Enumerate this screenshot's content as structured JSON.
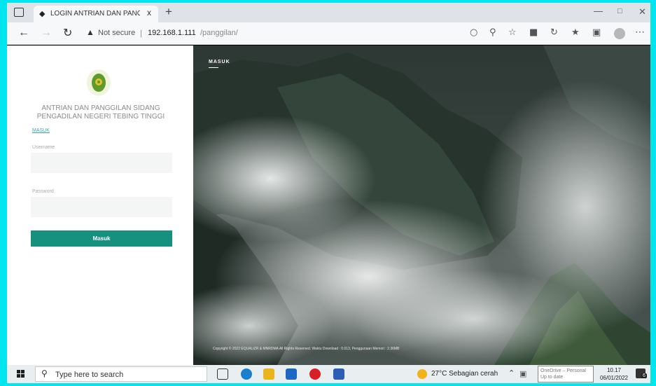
{
  "browser": {
    "tab_title": "LOGIN ANTRIAN DAN PANGGI...",
    "tab_favicon": "◆",
    "new_tab_symbol": "+",
    "close_symbol": "x",
    "not_secure": "Not secure",
    "url_host": "192.168.1.111",
    "url_path": "/panggilan/"
  },
  "login": {
    "title_line1": "ANTRIAN DAN PANGGILAN SIDANG",
    "title_line2": "PENGADILAN NEGERI TEBING TINGGI",
    "tab_label": "MASUK",
    "username_label": "Username",
    "password_label": "Password",
    "submit_label": "Masuk"
  },
  "hero": {
    "label": "MASUK",
    "footer": "Copyright © 2022 EQUALIZR & MNRDMA All Rights Reserved. Waktu Download : 0.013, Penggunaan Memori : 2.36MB"
  },
  "taskbar": {
    "search_placeholder": "Type here to search",
    "weather": "27°C  Sebagian cerah",
    "onedrive_line1": "OneDrive – Personal",
    "onedrive_line2": "Up to date",
    "time": "10.17",
    "date": "06/01/2022",
    "notification_count": "6"
  },
  "colors": {
    "accent": "#17917f",
    "screen_border": "#00e5ee"
  },
  "icons": [
    "back-arrow-icon",
    "forward-arrow-icon",
    "reload-icon",
    "warning-icon",
    "windows-start-icon",
    "search-icon",
    "weather-icon"
  ]
}
